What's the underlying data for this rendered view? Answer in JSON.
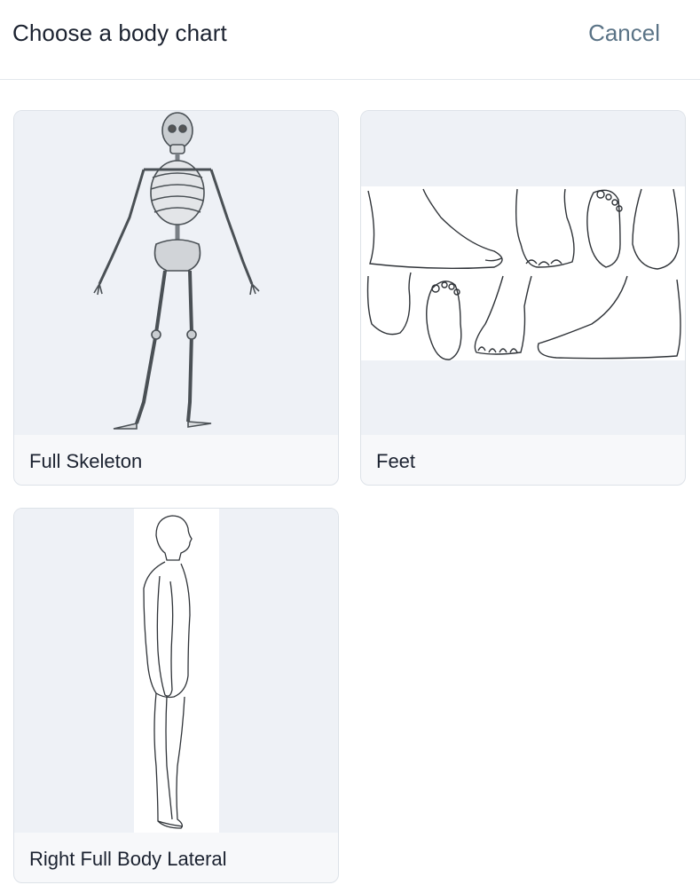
{
  "header": {
    "title": "Choose a body chart",
    "cancel_label": "Cancel"
  },
  "charts": [
    {
      "label": "Full Skeleton",
      "image": "skeleton-illustration"
    },
    {
      "label": "Feet",
      "image": "feet-illustration"
    },
    {
      "label": "Right Full Body Lateral",
      "image": "body-lateral-illustration"
    }
  ],
  "colors": {
    "thumb_bg": "#eef1f6",
    "card_bg": "#f7f8fa",
    "cancel": "#5a7386"
  }
}
